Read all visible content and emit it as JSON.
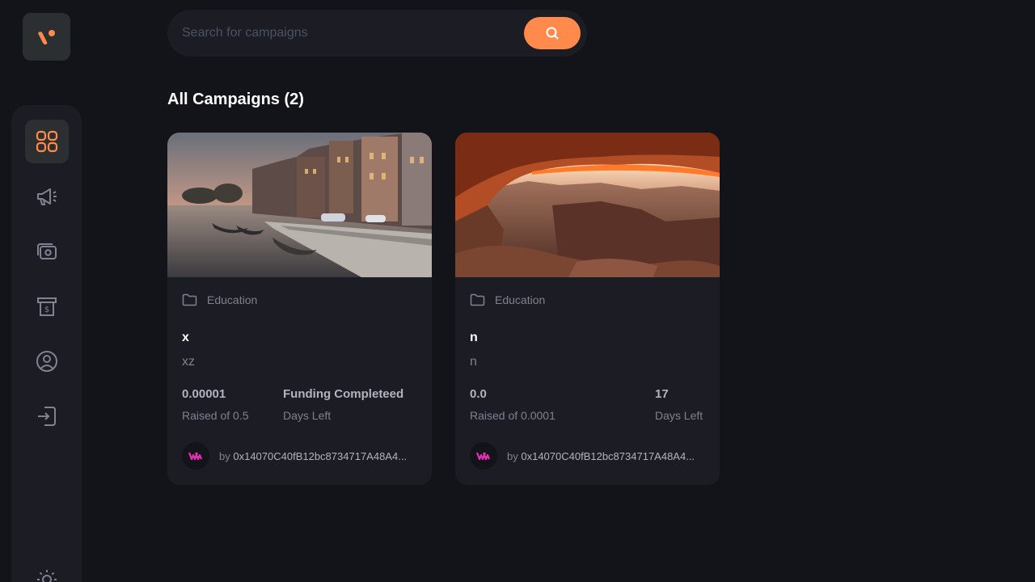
{
  "brand": {
    "accent": "#ff8a4c",
    "background": "#13131a",
    "surface": "#1c1c24"
  },
  "sidebar": {
    "items": [
      {
        "name": "dashboard",
        "icon": "dashboard-grid-icon",
        "active": true
      },
      {
        "name": "campaign",
        "icon": "megaphone-icon",
        "active": false
      },
      {
        "name": "payment",
        "icon": "money-icon",
        "active": false
      },
      {
        "name": "withdraw",
        "icon": "withdraw-icon",
        "active": false
      },
      {
        "name": "profile",
        "icon": "profile-icon",
        "active": false
      },
      {
        "name": "logout",
        "icon": "logout-icon",
        "active": false
      }
    ],
    "theme_icon": "sun-icon"
  },
  "search": {
    "placeholder": "Search for campaigns",
    "value": "",
    "button_icon": "search-icon"
  },
  "main": {
    "title": "All Campaigns (2)"
  },
  "campaigns": [
    {
      "category": "Education",
      "title": "x",
      "description": "xz",
      "collected": "0.00001",
      "target_label": "Raised of 0.5",
      "days_value": "Funding Completeed",
      "days_label": "Days Left",
      "owner_prefix": "by",
      "owner": "0x14070C40fB12bc8734717A48A4..."
    },
    {
      "category": "Education",
      "title": "n",
      "description": "n",
      "collected": "0.0",
      "target_label": "Raised of 0.0001",
      "days_value": "17",
      "days_label": "Days Left",
      "owner_prefix": "by",
      "owner": "0x14070C40fB12bc8734717A48A4..."
    }
  ]
}
